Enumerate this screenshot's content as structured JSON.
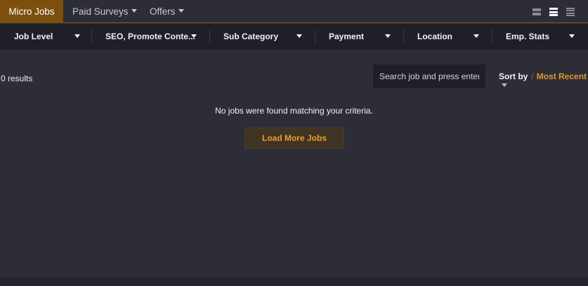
{
  "tabs": [
    {
      "label": "Micro Jobs",
      "active": true
    },
    {
      "label": "Paid Surveys",
      "dropdown": true
    },
    {
      "label": "Offers",
      "dropdown": true
    }
  ],
  "view_toggles": [
    "grid-view-icon",
    "list-view-icon",
    "compact-list-view-icon"
  ],
  "filters": [
    {
      "label": "Job Level"
    },
    {
      "label": "SEO, Promote Conte..."
    },
    {
      "label": "Sub Category"
    },
    {
      "label": "Payment"
    },
    {
      "label": "Location"
    },
    {
      "label": "Emp. Stats"
    }
  ],
  "results": {
    "count_text": "0 results"
  },
  "search": {
    "placeholder": "Search job and press enter..."
  },
  "sort": {
    "label": "Sort by",
    "separator": "/",
    "value": "Most Recent"
  },
  "empty_message": "No jobs were found matching your criteria.",
  "load_more_label": "Load More Jobs",
  "colors": {
    "accent": "#7c4f0c",
    "sort_value": "#e3972a",
    "load_more_text": "#ee9a2e",
    "background": "#2d2d38",
    "bar": "#1f1f28"
  }
}
